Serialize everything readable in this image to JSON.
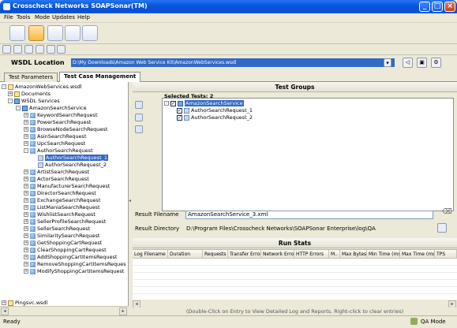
{
  "window": {
    "title": "Crosscheck Networks SOAPSonar(TM)"
  },
  "menu": [
    "File",
    "Tools",
    "Mode",
    "Updates",
    "Help"
  ],
  "wsdl": {
    "label": "WSDL Location",
    "value": "D:\\My Downloads\\Amazon Web Service Kit\\AmazonWebServices.wsdl"
  },
  "tabs": [
    "Test Parameters",
    "Test Case Management"
  ],
  "tree": {
    "root": "AmazonWebServices.wsdl",
    "documents": "Documents",
    "services": "WSDL Services",
    "service": "AmazonSearchService",
    "requests_before": [
      "KeywordSearchRequest",
      "PowerSearchRequest",
      "BrowseNodeSearchRequest",
      "AsinSearchRequest",
      "UpcSearchRequest",
      "AuthorSearchRequest"
    ],
    "children": [
      "AuthorSearchRequest_1",
      "AuthorSearchRequest_2"
    ],
    "requests_after": [
      "ArtistSearchRequest",
      "ActorSearchRequest",
      "ManufacturerSearchRequest",
      "DirectorSearchRequest",
      "ExchangeSearchRequest",
      "ListManiaSearchRequest",
      "WishlistSearchRequest",
      "SellerProfileSearchRequest",
      "SellerSearchRequest",
      "SimilaritySearchRequest",
      "GetShoppingCartRequest",
      "ClearShoppingCartRequest",
      "AddShoppingCartItemsRequest",
      "RemoveShoppingCartItemsReques",
      "ModifyShoppingCartItemsRequest"
    ],
    "last_root": "Pingsvc.wsdl"
  },
  "test_groups": {
    "title": "Test Groups",
    "selected_label": "Selected Tests: 2",
    "group": "AmazonSearchService",
    "items": [
      "AuthorSearchRequest_1",
      "AuthorSearchRequest_2"
    ]
  },
  "result": {
    "filename_label": "Result Filename",
    "filename_value": "AmazonSearchService_3.xml",
    "directory_label": "Result Directory",
    "directory_value": "D:\\Program Files\\Crosscheck Networks\\SOAPSonar Enterprise\\log\\QA"
  },
  "run_stats": {
    "title": "Run Stats",
    "columns": [
      "Log Filename",
      "Duration",
      "Requests",
      "Transfer Errors",
      "Network Errors",
      "HTTP Errors",
      "M..",
      "Max Bytes",
      "Min Time (ms)",
      "Max Time (ms)",
      "TPS"
    ],
    "hint": "(Double-Click on Entry to View Detailed Log and Reports.  Right-click to clear entries)"
  },
  "status": {
    "left": "Ready",
    "mode": "QA Mode"
  }
}
